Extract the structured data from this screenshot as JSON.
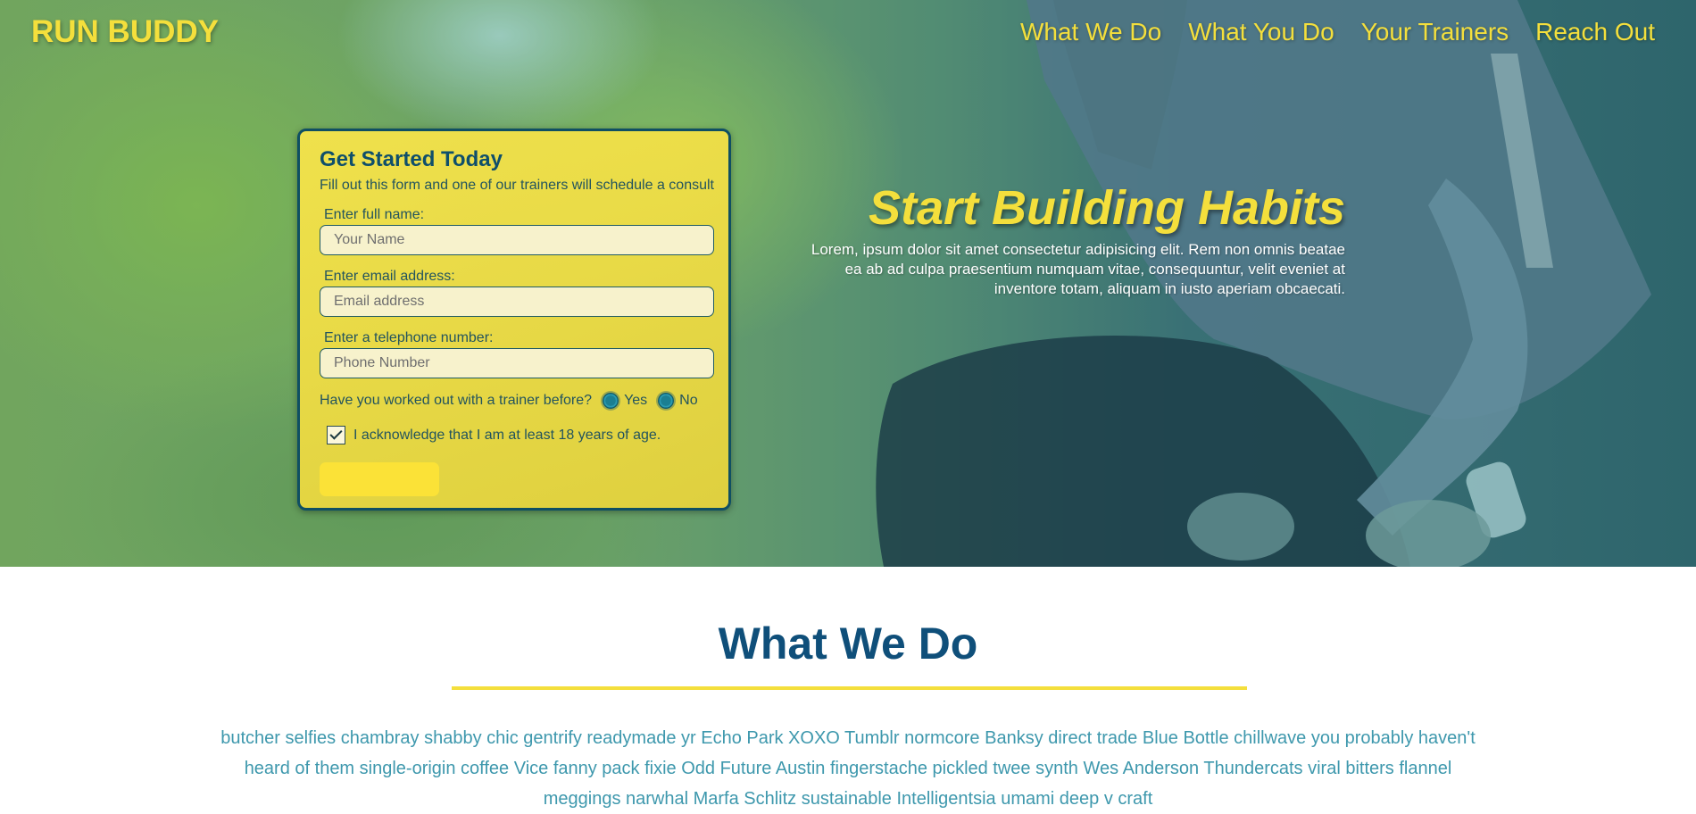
{
  "header": {
    "logo": "RUN BUDDY",
    "nav": [
      "What We Do",
      "What You Do",
      "Your Trainers",
      "Reach Out"
    ]
  },
  "form": {
    "title": "Get Started Today",
    "description": "Fill out this form and one of our trainers will schedule a consult",
    "fields": [
      {
        "label": "Enter full name:",
        "placeholder": "Your Name"
      },
      {
        "label": "Enter email address:",
        "placeholder": "Email address"
      },
      {
        "label": "Enter a telephone number:",
        "placeholder": "Phone Number"
      }
    ],
    "radio_question": "Have you worked out with a trainer before?",
    "radio_options": [
      "Yes",
      "No"
    ],
    "checkbox_label": "I acknowledge that I am at least 18 years of age.",
    "checkbox_checked": true,
    "submit_label": ""
  },
  "hero": {
    "heading": "Start Building Habits",
    "paragraph": "Lorem, ipsum dolor sit amet consectetur adipisicing elit. Rem non omnis beatae ea ab ad culpa praesentium numquam vitae, consequuntur, velit eveniet at inventore totam, aliquam in iusto aperiam obcaecati."
  },
  "what_we_do": {
    "title": "What We Do",
    "text": "butcher selfies chambray shabby chic gentrify readymade yr Echo Park XOXO Tumblr normcore Banksy direct trade Blue Bottle chillwave you probably haven't heard of them single-origin coffee Vice fanny pack fixie Odd Future Austin fingerstache pickled twee synth Wes Anderson Thundercats viral bitters flannel meggings narwhal Marfa Schlitz sustainable Intelligentsia umami deep v craft"
  },
  "colors": {
    "accent_yellow": "#f4df3c",
    "primary_blue": "#0f4f7a",
    "body_text_teal": "#3e98ad"
  }
}
